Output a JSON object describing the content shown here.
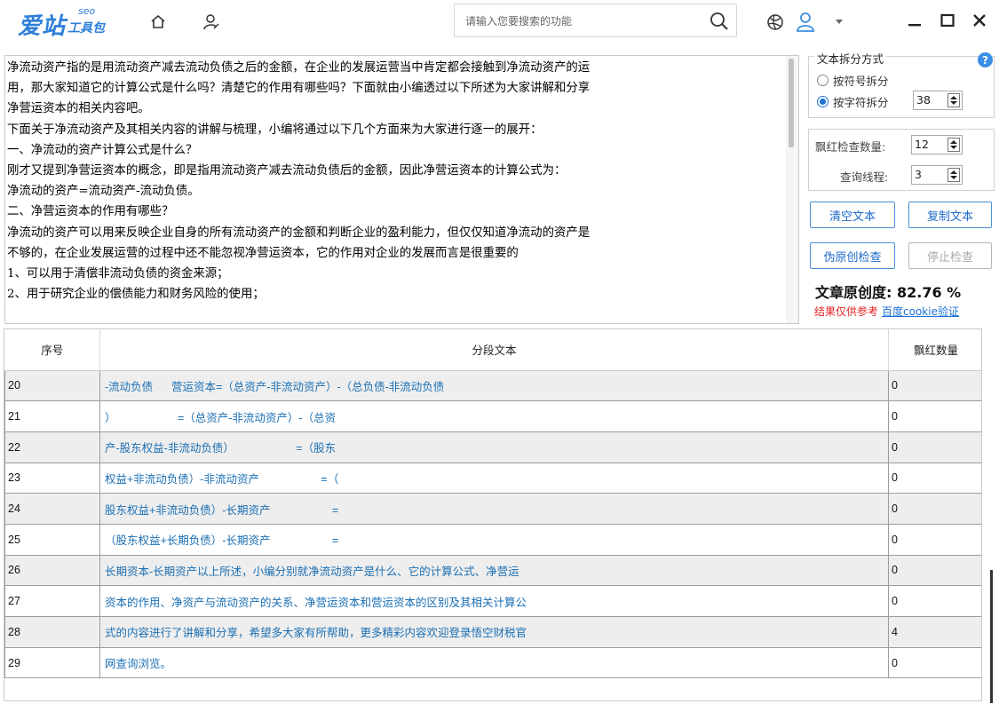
{
  "app": {
    "logo_main": "爱站",
    "logo_seo": "seo",
    "logo_tool": "工具包"
  },
  "search": {
    "placeholder": "请输入您要搜索的功能"
  },
  "editor": {
    "text": "净流动资产指的是用流动资产减去流动负债之后的金额，在企业的发展运营当中肯定都会接触到净流动资产的运\n用，那大家知道它的计算公式是什么吗？清楚它的作用有哪些吗？下面就由小编透过以下所述为大家讲解和分享\n净营运资本的相关内容吧。\n下面关于净流动资产及其相关内容的讲解与梳理，小编将通过以下几个方面来为大家进行逐一的展开：\n一、净流动的资产计算公式是什么？\n刚才又提到净营运资本的概念，即是指用流动资产减去流动负债后的金额，因此净营运资本的计算公式为：\n净流动的资产=流动资产-流动负债。\n二、净营运资本的作用有哪些？\n净流动的资产可以用来反映企业自身的所有流动资产的金额和判断企业的盈利能力，但仅仅知道净流动的资产是\n不够的，在企业发展运营的过程中还不能忽视净营运资本，它的作用对企业的发展而言是很重要的\n1、可以用于清偿非流动负债的资金来源；\n2、用于研究企业的偿债能力和财务风险的使用；"
  },
  "split": {
    "legend": "文本拆分方式",
    "option_symbol": "按符号拆分",
    "option_char": "按字符拆分",
    "char_count": "38",
    "selected": "char"
  },
  "settings": {
    "redcheck_label": "飘红检查数量:",
    "redcheck_value": "12",
    "threads_label": "查询线程:",
    "threads_value": "3"
  },
  "buttons": {
    "clear": "清空文本",
    "copy": "复制文本",
    "check": "伪原创检查",
    "stop": "停止检查"
  },
  "result": {
    "score_label": "文章原创度:",
    "score_value": "82.76 %",
    "note": "结果仅供参考",
    "link": "百度cookie验证"
  },
  "table": {
    "headers": [
      "序号",
      "分段文本",
      "飘红数量"
    ],
    "rows": [
      {
        "no": "20",
        "text": "-流动负债      营运资本=（总资产-非流动资产）-（总负债-非流动负债",
        "count": "0"
      },
      {
        "no": "21",
        "text": "）                    =（总资产-非流动资产）-（总资",
        "count": "0"
      },
      {
        "no": "22",
        "text": "产-股东权益-非流动负债）                    =（股东",
        "count": "0"
      },
      {
        "no": "23",
        "text": "权益+非流动负债）-非流动资产                    =（",
        "count": "0"
      },
      {
        "no": "24",
        "text": "股东权益+非流动负债）-长期资产                    =",
        "count": "0"
      },
      {
        "no": "25",
        "text": "（股东权益+长期负债）-长期资产                    =",
        "count": "0"
      },
      {
        "no": "26",
        "text": "长期资本-长期资产以上所述，小编分别就净流动资产是什么、它的计算公式、净营运",
        "count": "0"
      },
      {
        "no": "27",
        "text": "资本的作用、净资产与流动资产的关系、净营运资本和营运资本的区别及其相关计算公",
        "count": "0"
      },
      {
        "no": "28",
        "text": "式的内容进行了讲解和分享，希望多大家有所帮助，更多精彩内容欢迎登录悟空财税官",
        "count": "4"
      },
      {
        "no": "29",
        "text": "网查询浏览。",
        "count": "0"
      }
    ]
  },
  "colors": {
    "accent": "#1a73d9",
    "highlight": "#e53535",
    "segment_text": "#1b6fb3"
  }
}
